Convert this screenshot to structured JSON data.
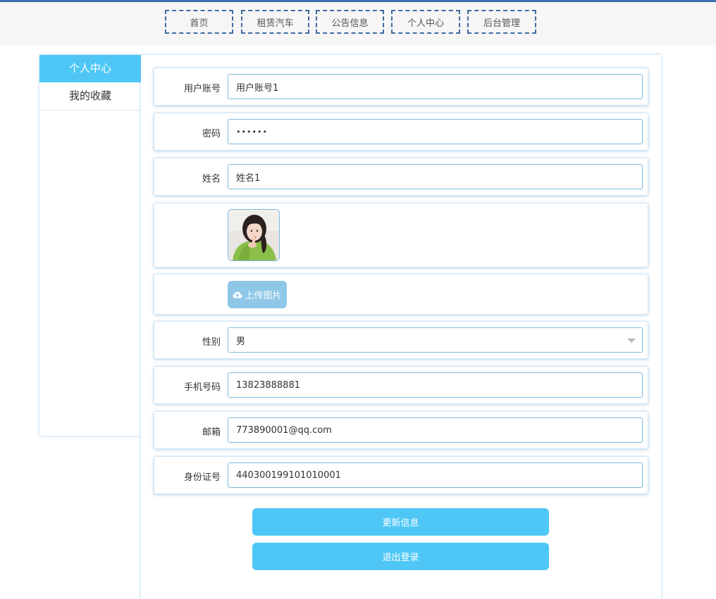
{
  "nav": {
    "items": [
      {
        "label": "首页"
      },
      {
        "label": "租赁汽车"
      },
      {
        "label": "公告信息"
      },
      {
        "label": "个人中心"
      },
      {
        "label": "后台管理"
      }
    ]
  },
  "sidebar": {
    "items": [
      {
        "label": "个人中心",
        "active": true
      },
      {
        "label": "我的收藏",
        "active": false
      }
    ]
  },
  "form": {
    "username": {
      "label": "用户账号",
      "value": "用户账号1"
    },
    "password": {
      "label": "密码",
      "value": "••••••"
    },
    "name": {
      "label": "姓名",
      "value": "姓名1"
    },
    "avatar": {
      "alt": "avatar photo"
    },
    "upload": {
      "label": "上传图片",
      "icon": "cloud-upload-icon"
    },
    "gender": {
      "label": "性别",
      "value": "男"
    },
    "phone": {
      "label": "手机号码",
      "value": "13823888881"
    },
    "email": {
      "label": "邮箱",
      "value": "773890001@qq.com"
    },
    "idcard": {
      "label": "身份证号",
      "value": "440300199101010001"
    }
  },
  "actions": {
    "update_label": "更新信息",
    "logout_label": "退出登录"
  },
  "colors": {
    "accent": "#4ec7f6",
    "upload_button": "#8ec7e8",
    "nav_border": "#3d6b9f",
    "top_line": "#3d6fb0"
  }
}
